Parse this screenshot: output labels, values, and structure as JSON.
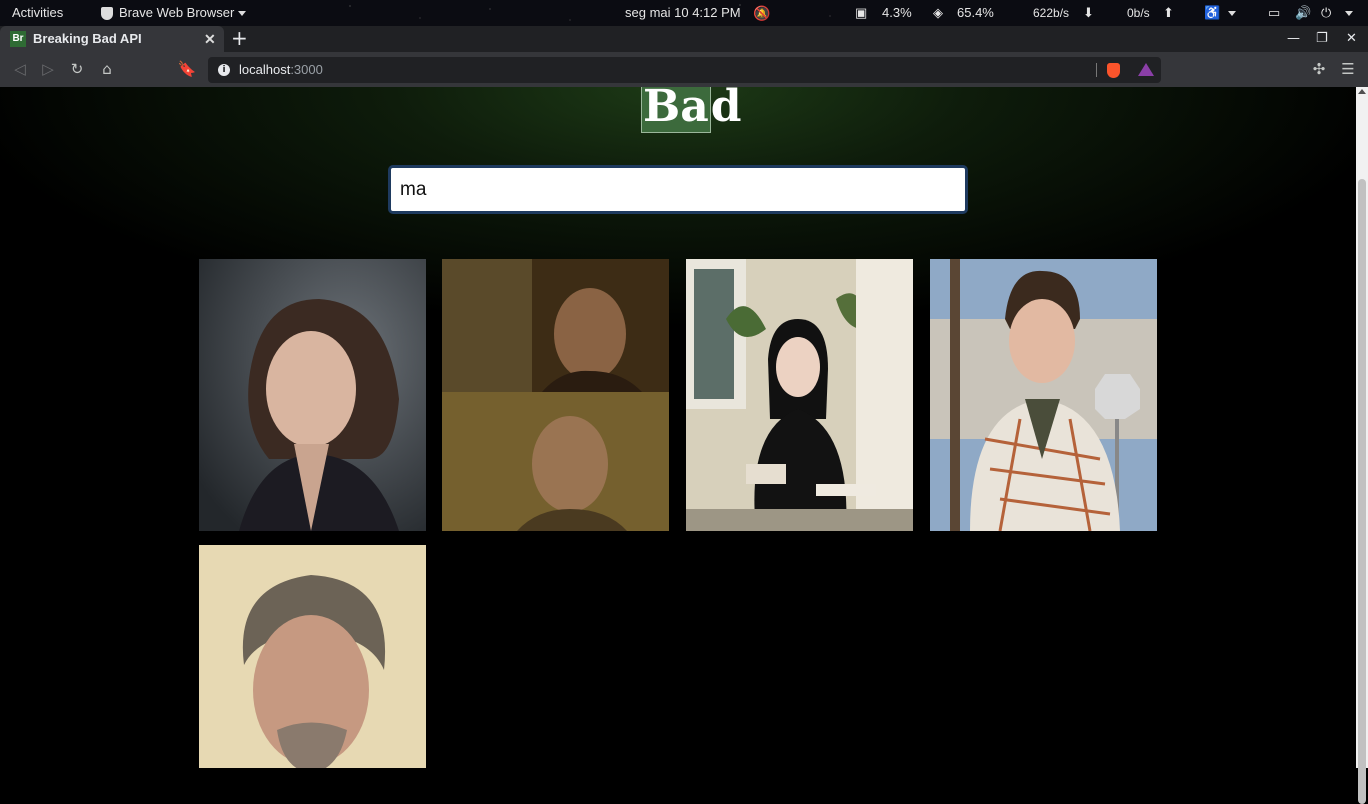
{
  "system_bar": {
    "activities": "Activities",
    "app_name": "Brave Web Browser",
    "clock": "seg mai 10   4:12 PM",
    "cpu": "4.3%",
    "memory": "65.4%",
    "net_down": "622b/s",
    "net_up": "0b/s"
  },
  "browser": {
    "tab_title": "Breaking Bad API",
    "favicon_text": "Br",
    "url_host": "localhost",
    "url_port": ":3000"
  },
  "page": {
    "logo_element": "Ba",
    "logo_rest": "d",
    "search_value": "ma",
    "characters": [
      {
        "name": "marie-schrader-photo"
      },
      {
        "name": "cousins-salamanca-photo"
      },
      {
        "name": "jane-margolis-photo"
      },
      {
        "name": "brandon-mayhew-photo"
      },
      {
        "name": "ted-beneke-photo"
      }
    ]
  },
  "colors": {
    "accent_green": "#3c6a3c",
    "search_border": "#1e3a5f"
  }
}
